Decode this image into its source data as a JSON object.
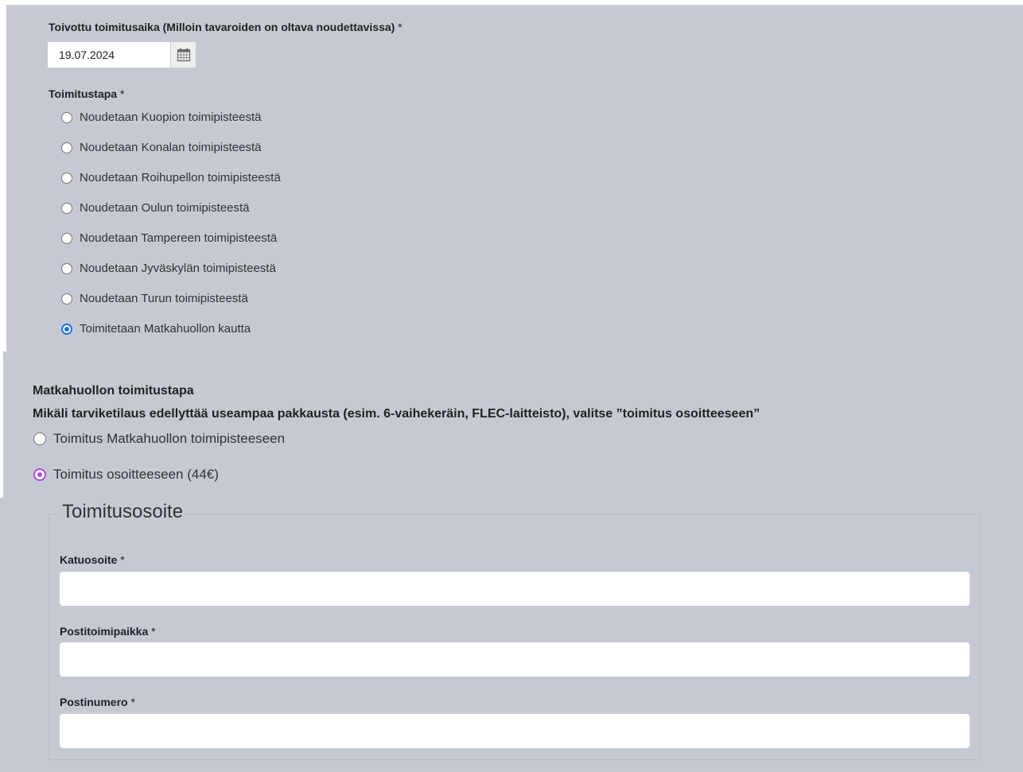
{
  "delivery_date": {
    "label": "Toivottu toimitusaika (Milloin tavaroiden on oltava noudettavissa)",
    "required_mark": "*",
    "value": "19.07.2024",
    "calendar_icon": "calendar-icon"
  },
  "delivery_method": {
    "label": "Toimitustapa",
    "required_mark": "*",
    "selected_index": 7,
    "options": [
      "Noudetaan Kuopion toimipisteestä",
      "Noudetaan Konalan toimipisteestä",
      "Noudetaan Roihupellon toimipisteestä",
      "Noudetaan Oulun toimipisteestä",
      "Noudetaan Tampereen toimipisteestä",
      "Noudetaan Jyväskylän toimipisteestä",
      "Noudetaan Turun toimipisteestä",
      "Toimitetaan Matkahuollon kautta"
    ]
  },
  "matkahuolto": {
    "title": "Matkahuollon toimitustapa",
    "note": "Mikäli tarviketilaus edellyttää useampaa pakkausta (esim. 6-vaihekeräin, FLEC-laitteisto), valitse ”toimitus osoitteeseen”",
    "selected_index": 1,
    "options": [
      "Toimitus Matkahuollon toimipisteeseen",
      "Toimitus osoitteeseen (44€)"
    ]
  },
  "address": {
    "legend": "Toimitusosoite",
    "street": {
      "label": "Katuosoite",
      "required_mark": "*",
      "value": ""
    },
    "city": {
      "label": "Postitoimipaikka",
      "required_mark": "*",
      "value": ""
    },
    "postal_code": {
      "label": "Postinumero",
      "required_mark": "*",
      "value": ""
    }
  },
  "colors": {
    "panel_bg": "#c5c9d2",
    "radio_checked_blue": "#1a73e8",
    "radio_checked_purple": "#b04ad8"
  }
}
